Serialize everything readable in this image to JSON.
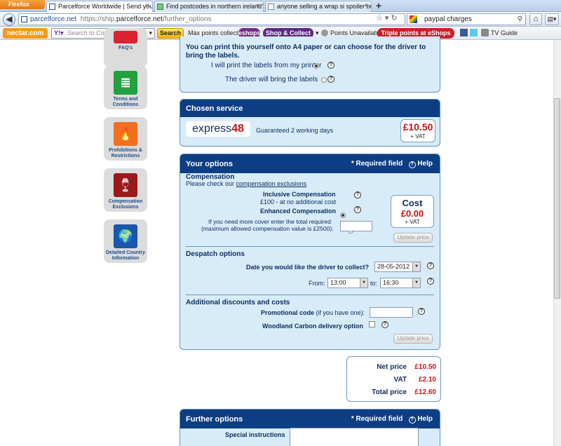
{
  "browser": {
    "menu_button": "Firefox",
    "tabs": [
      {
        "title": "Parcelforce Worldwide | Send your pa..."
      },
      {
        "title": "Find postcodes in northern ireland? -..."
      },
      {
        "title": "anyone selling a wrap si spoiler buy a..."
      }
    ],
    "url_domain": "parcelforce.net",
    "url_full_prefix": "https://ship.",
    "url_full_domain": "parcelforce.net",
    "url_path": "/further_options",
    "search_query": "paypal charges"
  },
  "toolbar": {
    "nectar_label": "nectar.com",
    "collect_placeholder": "Search to Collect",
    "search_button": "Search",
    "max_points": "Max points collected",
    "eshops": "eshops",
    "shop_collect": "Shop & Collect",
    "points_unavailable": "Points Unavailable",
    "triple_points": "Triple points at eShops",
    "tv_guide": "TV Guide"
  },
  "sidebar": {
    "items": [
      {
        "label": "FAQ's"
      },
      {
        "label": "Terms and Conditions"
      },
      {
        "label": "Prohibitions & Restrictions"
      },
      {
        "label": "Compensation Exclusions"
      },
      {
        "label": "Detailed Country Information"
      }
    ]
  },
  "labels_panel": {
    "intro": "You can print this yourself onto A4 paper or can choose for the driver to bring the labels.",
    "option_print": "I will print the labels from my printer",
    "option_driver": "The driver will bring the labels"
  },
  "chosen_service": {
    "title": "Chosen service",
    "service_name_prefix": "express",
    "service_name_number": "48",
    "description": "Guaranteed 2 working days",
    "price": "£10.50",
    "vat_note": "+ VAT"
  },
  "your_options": {
    "title": "Your options",
    "required_field": "* Required field",
    "help": "Help",
    "compensation": {
      "heading": "Compensation",
      "check_text": "Please check our ",
      "exclusions_link": "compensation exclusions",
      "inclusive_label": "Inclusive Compensation",
      "inclusive_sub": "£100 - at no additional cost",
      "enhanced_label": "Enhanced Compensation",
      "cover_text_1": "If you need more cover enter the total required",
      "cover_text_2": "(maximum allowed compensation value is £2500):",
      "cover_value": "",
      "cost_title": "Cost",
      "cost_value": "£0.00",
      "cost_vat": "+ VAT",
      "update_button": "Update price"
    },
    "despatch": {
      "heading": "Despatch options",
      "date_label": "Date you would like the driver to collect?",
      "date_value": "28-05-2012",
      "from_label": "From:",
      "from_value": "13:00",
      "to_label": "to:",
      "to_value": "16:30"
    },
    "discounts": {
      "heading": "Additional discounts and costs",
      "promo_label": "Promotional code",
      "promo_hint": " (if you have one):",
      "promo_value": "",
      "woodland_label": "Woodland Carbon delivery option",
      "update_button": "Update price"
    }
  },
  "totals": {
    "net_label": "Net price",
    "net_value": "£10.50",
    "vat_label": "VAT",
    "vat_value": "£2.10",
    "total_label": "Total price",
    "total_value": "£12.60"
  },
  "further_options": {
    "title": "Further options",
    "required_field": "* Required field",
    "help": "Help",
    "special_instructions": "Special instructions"
  }
}
